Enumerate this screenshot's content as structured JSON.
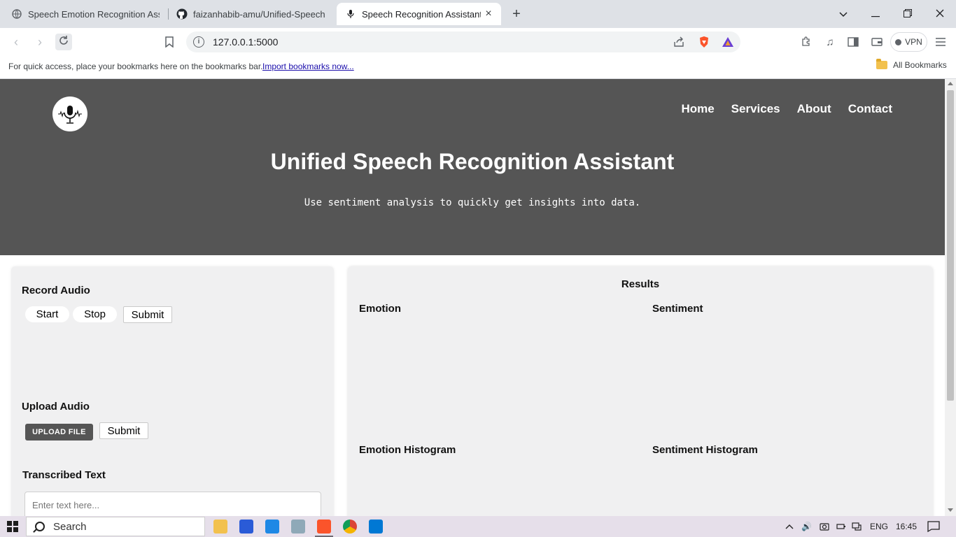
{
  "browser": {
    "tabs": [
      {
        "title": "Speech Emotion Recognition Assista",
        "active": false
      },
      {
        "title": "faizanhabib-amu/Unified-Speech-Re",
        "active": false
      },
      {
        "title": "Speech Recognition Assistant",
        "active": true
      }
    ],
    "url": "127.0.0.1:5000",
    "vpn_label": "VPN",
    "bookmarks_hint": "For quick access, place your bookmarks here on the bookmarks bar.",
    "bookmarks_import": "Import bookmarks now...",
    "all_bookmarks": "All Bookmarks"
  },
  "site": {
    "nav": [
      "Home",
      "Services",
      "About",
      "Contact"
    ],
    "title": "Unified Speech Recognition Assistant",
    "tagline": "Use sentiment analysis to quickly get insights into data.",
    "header_bg": "#555555"
  },
  "left_panel": {
    "record_heading": "Record Audio",
    "start_label": "Start",
    "stop_label": "Stop",
    "submit_label": "Submit",
    "upload_heading": "Upload Audio",
    "upload_label": "UPLOAD FILE",
    "upload_submit_label": "Submit",
    "transcribed_heading": "Transcribed Text",
    "text_placeholder": "Enter text here..."
  },
  "right_panel": {
    "results_heading": "Results",
    "emotion_heading": "Emotion",
    "sentiment_heading": "Sentiment",
    "emotion_hist_heading": "Emotion Histogram",
    "sentiment_hist_heading": "Sentiment Histogram"
  },
  "taskbar": {
    "search_label": "Search",
    "language": "ENG",
    "time": "16:45"
  }
}
